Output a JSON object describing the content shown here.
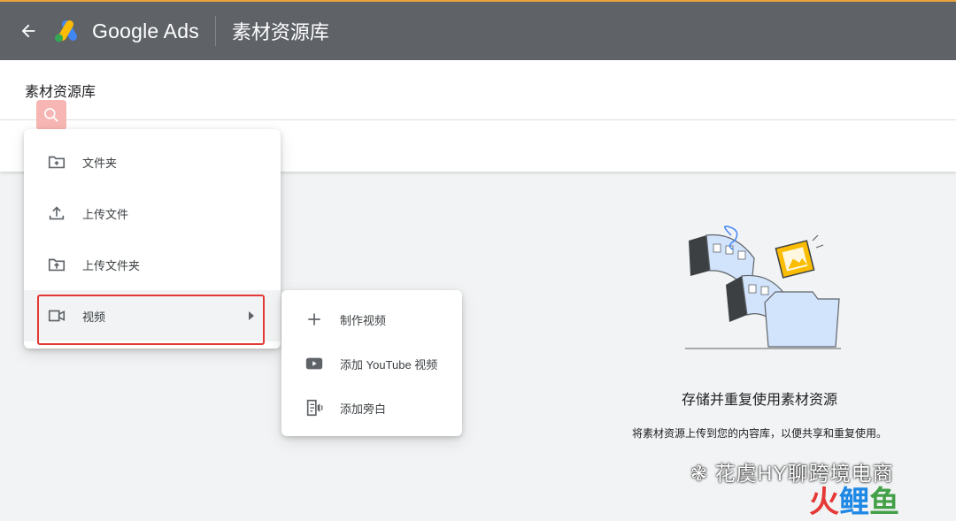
{
  "header": {
    "brand": "Google Ads",
    "page_title": "素材资源库"
  },
  "subheader": {
    "title": "素材资源库"
  },
  "menu": {
    "items": [
      {
        "label": "文件夹",
        "icon": "new-folder-icon"
      },
      {
        "label": "上传文件",
        "icon": "upload-icon"
      },
      {
        "label": "上传文件夹",
        "icon": "upload-folder-icon"
      },
      {
        "label": "视频",
        "icon": "video-camera-icon"
      }
    ]
  },
  "submenu": {
    "items": [
      {
        "label": "制作视频",
        "icon": "plus-icon"
      },
      {
        "label": "添加 YouTube 视频",
        "icon": "youtube-icon"
      },
      {
        "label": "添加旁白",
        "icon": "voiceover-icon"
      }
    ]
  },
  "empty_state": {
    "title": "存储并重复使用素材资源",
    "description": "将素材资源上传到您的内容库，以便共享和重复使用。"
  },
  "watermark": {
    "text": "花虞HY聊跨境电商",
    "logo_parts": [
      "火",
      "鲤",
      "鱼"
    ]
  },
  "colors": {
    "topbar": "#5f6368",
    "highlight": "#e53935",
    "accent_blue": "#4285f4",
    "accent_yellow": "#fbbc04",
    "accent_green": "#34a853"
  }
}
